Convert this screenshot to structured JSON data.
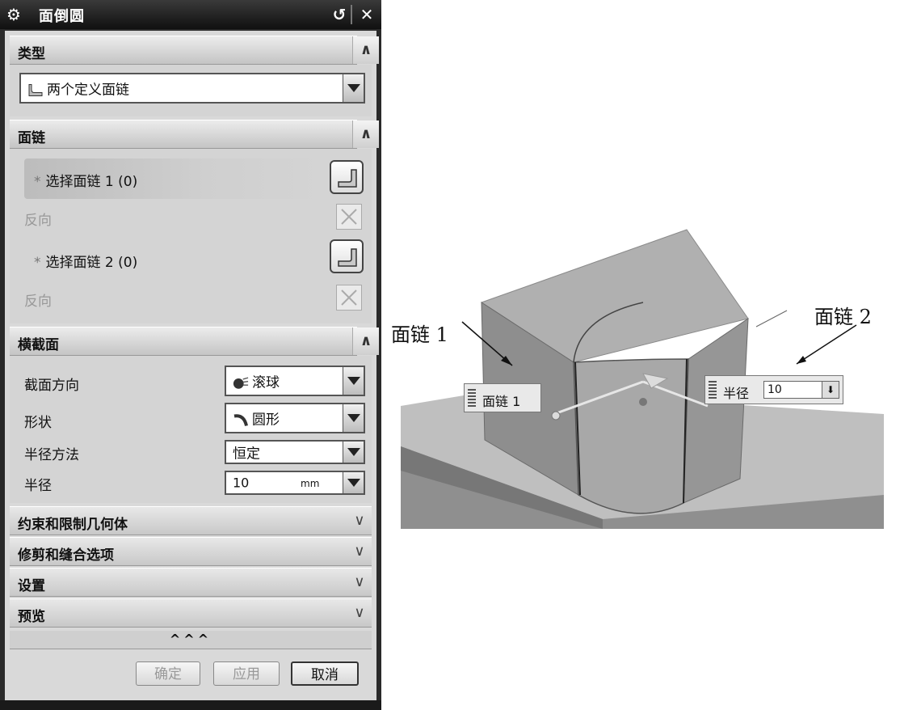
{
  "dialog": {
    "title": "面倒圆",
    "sections": {
      "type": {
        "header": "类型",
        "selected": "两个定义面链"
      },
      "face_chain": {
        "header": "面链",
        "select1": "选择面链 1 (0)",
        "reverse1": "反向",
        "select2": "选择面链 2 (0)",
        "reverse2": "反向",
        "asterisk": "*"
      },
      "cross_section": {
        "header": "横截面",
        "section_direction_label": "截面方向",
        "section_direction_value": "滚球",
        "shape_label": "形状",
        "shape_value": "圆形",
        "radius_method_label": "半径方法",
        "radius_method_value": "恒定",
        "radius_label": "半径",
        "radius_value": "10",
        "radius_unit": "mm"
      }
    },
    "collapsed_sections": [
      "约束和限制几何体",
      "修剪和缝合选项",
      "设置",
      "预览"
    ],
    "more_indicator": "^^^",
    "buttons": {
      "ok": "确定",
      "apply": "应用",
      "cancel": "取消"
    }
  },
  "figure": {
    "annotation_left": "面链 1",
    "annotation_right": "面链 2",
    "callout1_label": "面链 1",
    "callout2_label": "半径",
    "callout2_value": "10"
  }
}
